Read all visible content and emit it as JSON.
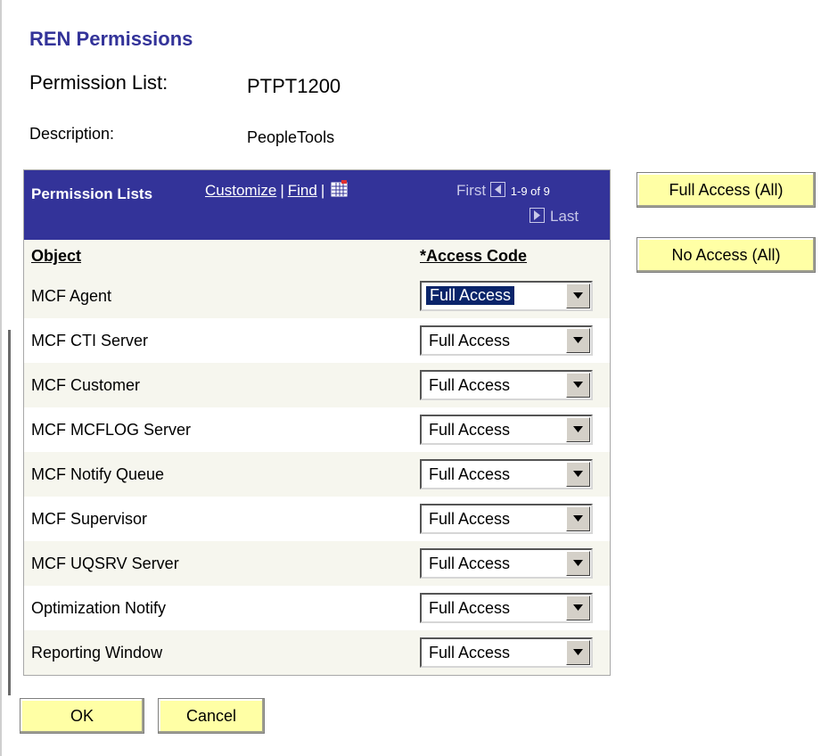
{
  "page": {
    "title": "REN Permissions"
  },
  "fields": {
    "permission_list_label": "Permission List:",
    "permission_list_value": "PTPT1200",
    "description_label": "Description:",
    "description_value": "PeopleTools"
  },
  "grid": {
    "title": "Permission Lists",
    "customize_link": "Customize",
    "find_link": "Find",
    "separator": "|",
    "nav_first": "First",
    "nav_range": "1-9 of 9",
    "nav_last": "Last",
    "columns": {
      "object": "Object",
      "access_code": "*Access Code"
    },
    "rows": [
      {
        "object": "MCF Agent",
        "access": "Full Access"
      },
      {
        "object": "MCF CTI Server",
        "access": "Full Access"
      },
      {
        "object": "MCF Customer",
        "access": "Full Access"
      },
      {
        "object": "MCF MCFLOG Server",
        "access": "Full Access"
      },
      {
        "object": "MCF Notify Queue",
        "access": "Full Access"
      },
      {
        "object": "MCF Supervisor",
        "access": "Full Access"
      },
      {
        "object": "MCF UQSRV Server",
        "access": "Full Access"
      },
      {
        "object": "Optimization Notify",
        "access": "Full Access"
      },
      {
        "object": "Reporting Window",
        "access": "Full Access"
      }
    ]
  },
  "buttons": {
    "full_access_all": "Full Access (All)",
    "no_access_all": "No Access (All)",
    "ok": "OK",
    "cancel": "Cancel"
  },
  "colors": {
    "header_bg": "#333399",
    "button_bg": "#ffffa5",
    "title_color": "#333399"
  },
  "icons": {
    "grid_view": "download-to-spreadsheet-icon",
    "prev": "arrow-left-icon",
    "next": "arrow-right-icon",
    "dropdown": "chevron-down-icon"
  }
}
